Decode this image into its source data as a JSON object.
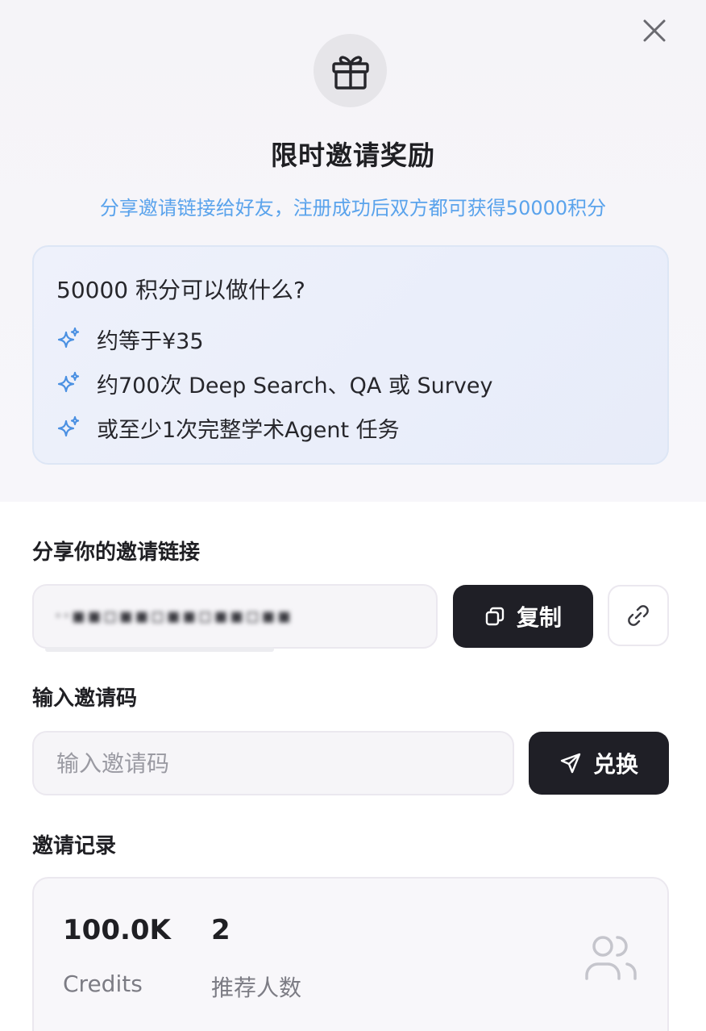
{
  "dialog": {
    "title": "限时邀请奖励",
    "subtitle": "分享邀请链接给好友，注册成功后双方都可获得50000积分"
  },
  "info_card": {
    "title": "50000 积分可以做什么?",
    "items": [
      {
        "icon": "sparkle-icon",
        "label": "约等于¥35"
      },
      {
        "icon": "sparkle-icon",
        "label": "约700次 Deep Search、QA 或 Survey"
      },
      {
        "icon": "sparkle-icon",
        "label": "或至少1次完整学术Agent 任务"
      }
    ]
  },
  "share_link": {
    "label": "分享你的邀请链接",
    "value": "··▪▪▫▪▪▫▪▪▫▪▪▫▪▪",
    "copy_label": "复制"
  },
  "invite_code": {
    "label": "输入邀请码",
    "placeholder": "输入邀请码",
    "value": "",
    "redeem_label": "兑换"
  },
  "records": {
    "label": "邀请记录",
    "credits_value": "100.0K",
    "credits_label": "Credits",
    "referrals_value": "2",
    "referrals_label": "推荐人数"
  },
  "colors": {
    "accent_text": "#5aa3ec",
    "sparkle": "#4a90e2",
    "dark_button": "#1f1f26"
  }
}
